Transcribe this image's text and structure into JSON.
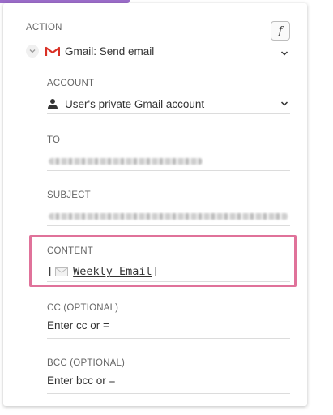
{
  "action": {
    "section_label": "ACTION",
    "fx_label": "f",
    "app_name": "Gmail: Send email"
  },
  "account": {
    "label": "ACCOUNT",
    "value": "User's private Gmail account"
  },
  "to": {
    "label": "TO"
  },
  "subject": {
    "label": "SUBJECT"
  },
  "content": {
    "label": "CONTENT",
    "open_bracket": "[",
    "pill_text": "Weekly Email",
    "close_bracket": "]"
  },
  "cc": {
    "label": "CC (OPTIONAL)",
    "placeholder": "Enter cc or ="
  },
  "bcc": {
    "label": "BCC (OPTIONAL)",
    "placeholder": "Enter bcc or ="
  },
  "colors": {
    "accent": "#9b6cc9",
    "highlight": "#e0729a",
    "gmail_red": "#d93025"
  }
}
